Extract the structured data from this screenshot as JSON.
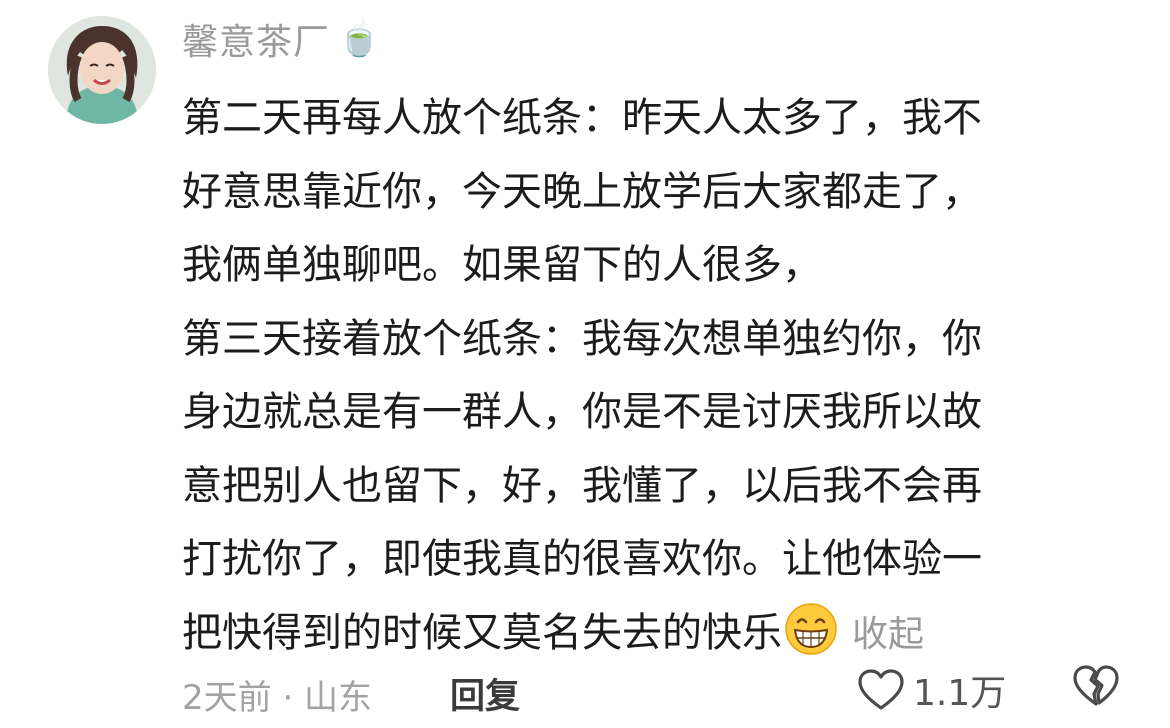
{
  "comment": {
    "username": "馨意茶厂",
    "badge_emoji": "🍵",
    "body_lines": [
      "第二天再每人放个纸条：昨天人太多了，我不",
      "好意思靠近你，今天晚上放学后大家都走了，",
      "我俩单独聊吧。如果留下的人很多，",
      "第三天接着放个纸条：我每次想单独约你，你",
      "身边就总是有一群人，你是不是讨厌我所以故",
      "意把别人也留下，好，我懂了，以后我不会再",
      "打扰你了，即使我真的很喜欢你。让他体验一",
      "把快得到的时候又莫名失去的快乐"
    ],
    "collapse_label": "收起",
    "time_location": "2天前 · 山东",
    "reply_label": "回复",
    "like_count": "1.1万"
  },
  "icons": {
    "avatar": "profile-photo-woman",
    "badge": "tea-cup-emoji",
    "inline_emoji": "grinning-face-emoji",
    "like": "heart-outline-icon",
    "dislike": "broken-heart-outline-icon"
  },
  "colors": {
    "text_primary": "#1c1c1c",
    "text_secondary": "#9a9a9a",
    "reply": "#3a3a3a"
  }
}
